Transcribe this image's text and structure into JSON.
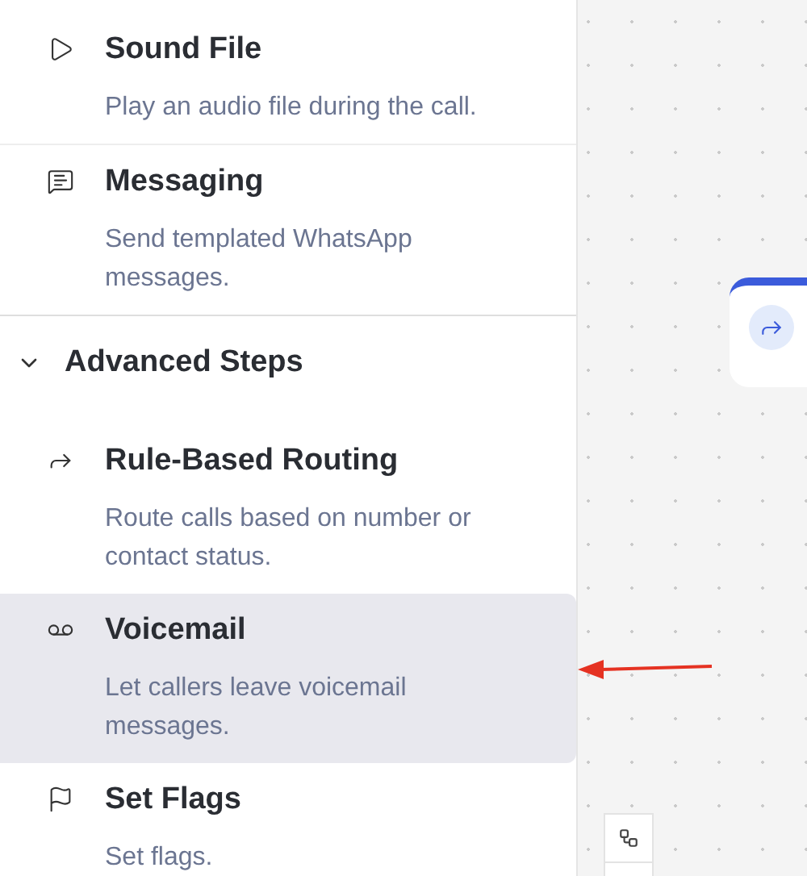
{
  "sidebar": {
    "sections": [
      {
        "items": [
          {
            "kind": "play",
            "title": "Sound File",
            "description": "Play an audio file during the call.",
            "selected": false
          },
          {
            "kind": "message",
            "title": "Messaging",
            "description": "Send templated WhatsApp messages.",
            "selected": false
          }
        ]
      },
      {
        "title": "Advanced Steps",
        "expanded": true,
        "items": [
          {
            "kind": "forward",
            "title": "Rule-Based Routing",
            "description": "Route calls based on number or contact status.",
            "selected": false
          },
          {
            "kind": "voicemail",
            "title": "Voicemail",
            "description": "Let callers leave voicemail messages.",
            "selected": true
          },
          {
            "kind": "flag",
            "title": "Set Flags",
            "description": "Set flags.",
            "selected": false
          }
        ]
      }
    ]
  }
}
